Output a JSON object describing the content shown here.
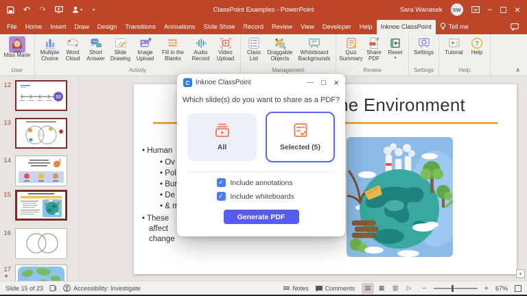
{
  "titlebar": {
    "title": "ClassPoint Examples - PowerPoint",
    "user_name": "Sara Wanasek",
    "user_initials": "SW"
  },
  "tabs": [
    "File",
    "Home",
    "Insert",
    "Draw",
    "Design",
    "Transitions",
    "Animations",
    "Slide Show",
    "Record",
    "Review",
    "View",
    "Developer",
    "Help",
    "Inknoe ClassPoint",
    "Tell me"
  ],
  "ribbon": {
    "groups": [
      {
        "label": "User",
        "buttons": [
          "Miss Marie"
        ]
      },
      {
        "label": "Activity",
        "buttons": [
          "Multiple Choice",
          "Word Cloud",
          "Short Answer",
          "Slide Drawing",
          "Image Upload",
          "Fill in the Blanks",
          "Audio Record",
          "Video Upload"
        ]
      },
      {
        "label": "Management",
        "buttons": [
          "Class List",
          "Draggable Objects",
          "Whiteboard Backgrounds"
        ]
      },
      {
        "label": "Review",
        "buttons": [
          "Quiz Summary",
          "Share PDF",
          "Reset"
        ]
      },
      {
        "label": "Settings",
        "buttons": [
          "Settings"
        ]
      },
      {
        "label": "Help",
        "buttons": [
          "Tutorial",
          "Help"
        ]
      }
    ]
  },
  "thumbnails": [
    {
      "number": "12"
    },
    {
      "number": "13"
    },
    {
      "number": "14"
    },
    {
      "number": "15"
    },
    {
      "number": "16"
    },
    {
      "number": "17",
      "star": "★"
    }
  ],
  "slide": {
    "title": "Human Impact on the Environment",
    "bullet_fragments": [
      {
        "text": "Human"
      },
      {
        "text": "Ov"
      },
      {
        "text": "Pol"
      },
      {
        "text": "Bur"
      },
      {
        "text": "De"
      },
      {
        "text": "& m"
      },
      {
        "text": "These"
      },
      {
        "text": "affect"
      },
      {
        "text": "change"
      }
    ]
  },
  "dialog": {
    "title": "Inknoe ClassPoint",
    "logo_letter": "C",
    "question": "Which slide(s) do you want to share as a PDF?",
    "option_all": "All",
    "option_selected": "Selected (5)",
    "checkbox_annotations": "Include annotations",
    "checkbox_whiteboards": "Include whiteboards",
    "generate_button": "Generate PDF",
    "check_glyph": "✓"
  },
  "statusbar": {
    "slide_indicator": "Slide 15 of 23",
    "accessibility": "Accessibility: Investigate",
    "notes_label": "Notes",
    "comments_label": "Comments",
    "zoom_level": "67%"
  },
  "colors": {
    "titlebar_red": "#BE4628",
    "dialog_accent": "#575CEF",
    "checkbox_blue": "#4E7BF5",
    "card_selected_border": "#6065EE",
    "icon_orange": "#F0744E",
    "thumb_border_maroon": "#7E2B23",
    "underline_orange": "#EFA93C",
    "slide_number_red": "#B5472D"
  }
}
